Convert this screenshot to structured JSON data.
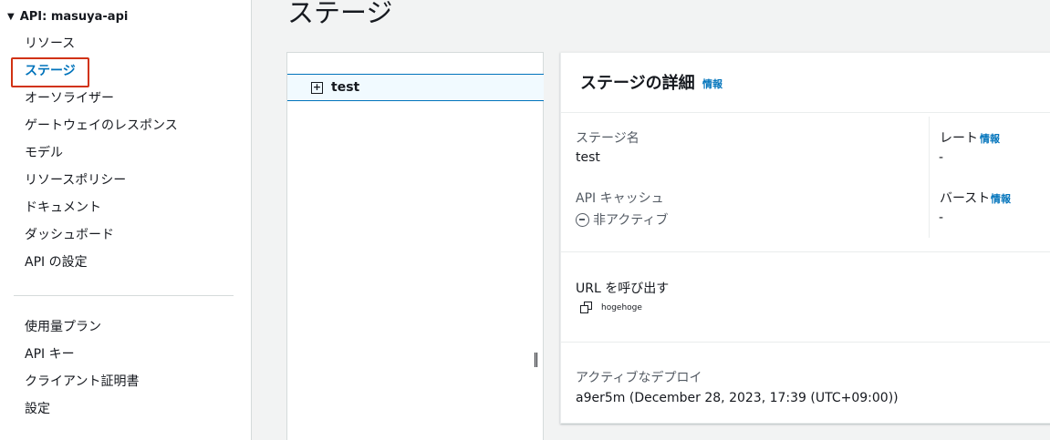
{
  "sidebar": {
    "api_title": "API: masuya-api",
    "items": [
      {
        "label": "リソース"
      },
      {
        "label": "ステージ"
      },
      {
        "label": "オーソライザー"
      },
      {
        "label": "ゲートウェイのレスポンス"
      },
      {
        "label": "モデル"
      },
      {
        "label": "リソースポリシー"
      },
      {
        "label": "ドキュメント"
      },
      {
        "label": "ダッシュボード"
      },
      {
        "label": "API の設定"
      }
    ],
    "secondary_items": [
      {
        "label": "使用量プラン"
      },
      {
        "label": "API キー"
      },
      {
        "label": "クライアント証明書"
      },
      {
        "label": "設定"
      }
    ]
  },
  "page": {
    "title": "ステージ"
  },
  "tree": {
    "stage_name": "test"
  },
  "details": {
    "title": "ステージの詳細",
    "info": "情報",
    "stage_name_label": "ステージ名",
    "stage_name_value": "test",
    "api_cache_label": "API キャッシュ",
    "api_cache_value": "非アクティブ",
    "rate_label": "レート",
    "rate_value": "-",
    "burst_label": "バースト",
    "burst_value": "-",
    "invoke_url_label": "URL を呼び出す",
    "invoke_url_value": "hogehoge",
    "active_deployment_label": "アクティブなデプロイ",
    "active_deployment_value": "a9er5m (December 28, 2023, 17:39 (UTC+09:00))"
  },
  "colors": {
    "accent": "#0073bb",
    "highlight_box": "#d13212",
    "background": "#f2f3f3"
  }
}
